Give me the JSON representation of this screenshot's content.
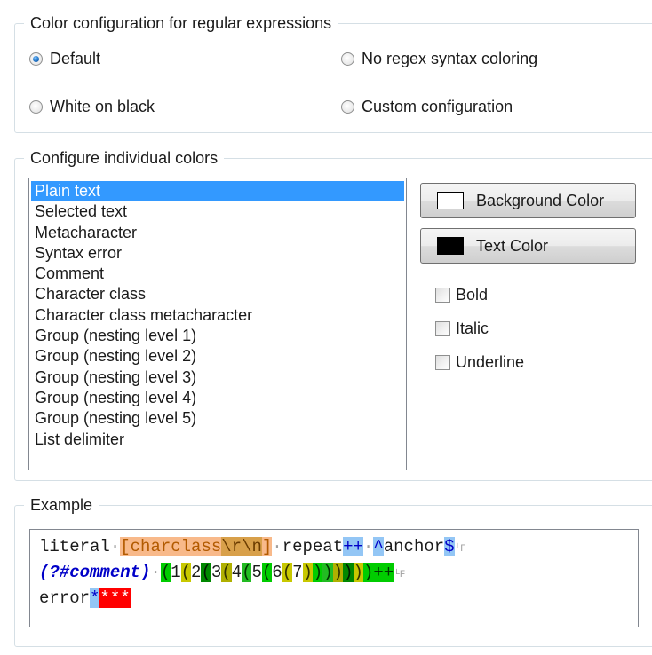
{
  "color_config": {
    "legend": "Color configuration for regular expressions",
    "options": [
      {
        "label": "Default",
        "selected": true
      },
      {
        "label": "No regex syntax coloring",
        "selected": false
      },
      {
        "label": "White on black",
        "selected": false
      },
      {
        "label": "Custom configuration",
        "selected": false
      }
    ]
  },
  "individual": {
    "legend": "Configure individual colors",
    "items": [
      "Plain text",
      "Selected text",
      "Metacharacter",
      "Syntax error",
      "Comment",
      "Character class",
      "Character class metacharacter",
      "Group (nesting level 1)",
      "Group (nesting level 2)",
      "Group (nesting level 3)",
      "Group (nesting level 4)",
      "Group (nesting level 5)",
      "List delimiter"
    ],
    "selected_index": 0,
    "background_button": "Background Color",
    "text_button": "Text Color",
    "background_swatch": "#ffffff",
    "text_swatch": "#000000",
    "bold": "Bold",
    "italic": "Italic",
    "underline": "Underline"
  },
  "example": {
    "legend": "Example",
    "l1": {
      "literal": "literal",
      "sep": "·",
      "cc_open": "[charclass",
      "cc_meta": "\\r\\n",
      "cc_close": "]",
      "repeat": "repeat",
      "plusplus": "++",
      "caret": "^",
      "anchor": "anchor",
      "dollar": "$",
      "lt": "└F"
    },
    "l2": {
      "comment": "(?#comment)",
      "sep": "·",
      "p1": "(",
      "n1": "1",
      "p2": "(",
      "n2": "2",
      "p3": "(",
      "n3": "3",
      "p4": "(",
      "n4": "4",
      "p5": "(",
      "n5": "5",
      "p6": "(",
      "n6": "6",
      "p7": "(",
      "n7": "7",
      "c7": ")",
      "c6": ")",
      "c5": ")",
      "c4": ")",
      "c3": ")",
      "c2": ")",
      "c1": ")",
      "plusplus": "++",
      "lt": "└F"
    },
    "l3": {
      "error": "error",
      "star": "*",
      "errstars": "***"
    }
  }
}
